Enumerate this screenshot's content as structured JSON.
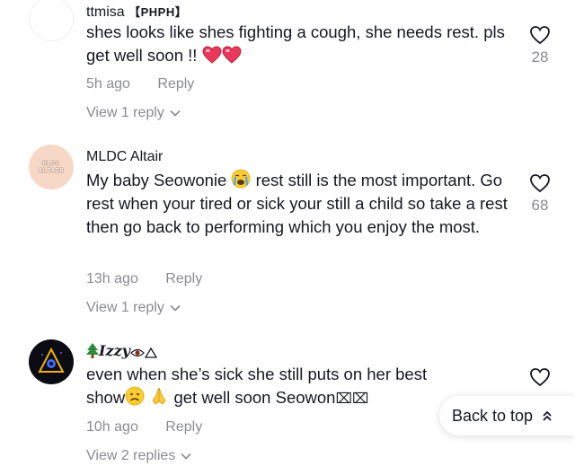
{
  "comments": [
    {
      "username": "ttmisa",
      "flag": "【PHPH】",
      "text": "shes looks like shes fighting a cough, she needs rest. pls get well soon !!",
      "emoji_suffix": [
        "red-heart-icon",
        "red-heart-icon"
      ],
      "time": "5h ago",
      "reply_label": "Reply",
      "likes": "28",
      "view_replies": "View 1 reply"
    },
    {
      "username": "MLDC Altair",
      "avatar_text": [
        "MLDC",
        "ALTAIR"
      ],
      "text_before_emoji": "My baby Seowonie",
      "emoji": "loudly-crying-face-icon",
      "text_after_emoji": "rest still is the most important. Go rest when your tired or sick your still a child so take a rest then go back to performing which you enjoy the most.",
      "time": "13h ago",
      "reply_label": "Reply",
      "likes": "68",
      "view_replies": "View 1 reply"
    },
    {
      "username": "𝑰𝒛𝒛𝒚",
      "username_prefix_icon": "evergreen-tree-icon",
      "username_suffix_icons": [
        "eye-icon",
        "triangle-icon"
      ],
      "text_line1": "even when she’s sick she still puts on her best",
      "text_line2_start": "show",
      "text_line2_emojis": [
        "frowning-face-icon",
        "folded-hands-icon"
      ],
      "text_line2_end": "get well soon Seowon",
      "text_line2_tail": "⌧⌧",
      "time": "10h ago",
      "reply_label": "Reply",
      "likes": "",
      "view_replies": "View 2 replies"
    }
  ],
  "back_to_top": {
    "label": "Back to top",
    "icon": "double-chevron-up-icon"
  },
  "colors": {
    "text": "#161823",
    "muted": "#8a8b91",
    "heart": "#e8395c"
  }
}
